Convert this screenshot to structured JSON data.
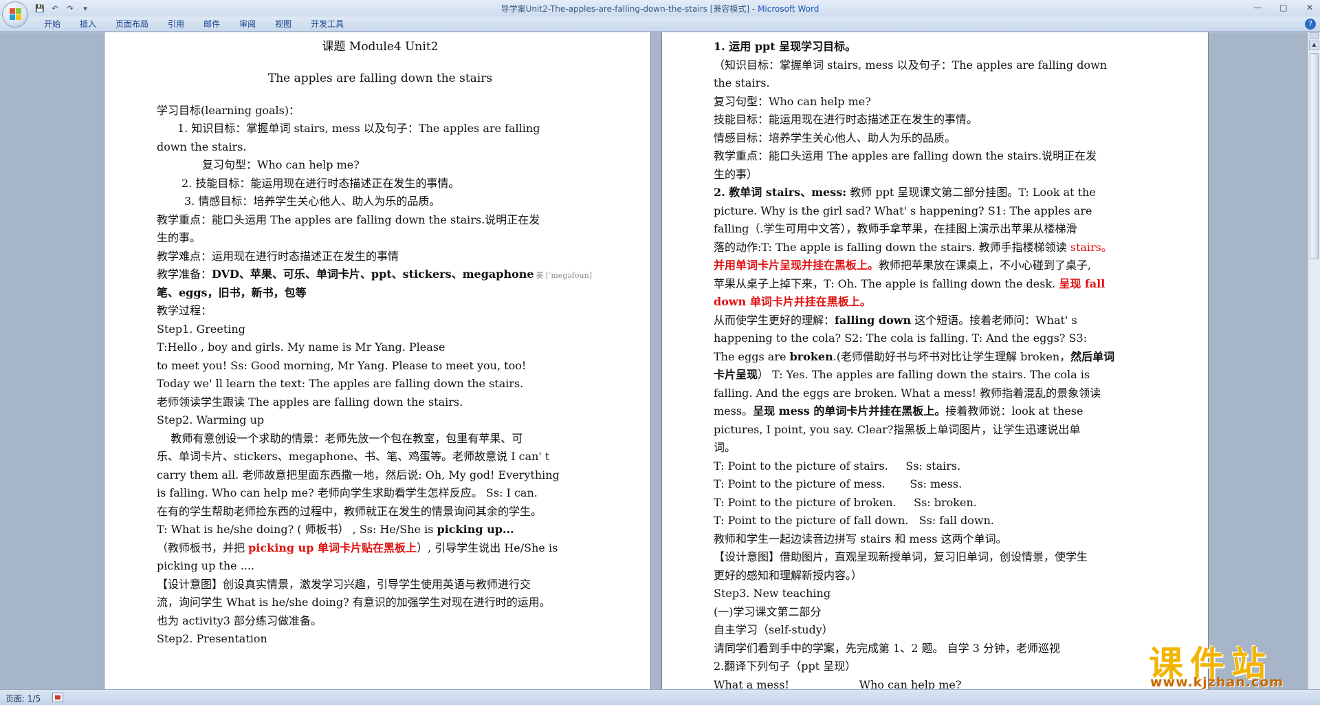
{
  "window": {
    "title": "导学案Unit2-The-apples-are-falling-down-the-stairs [兼容模式] - ",
    "app_name": "Microsoft Word",
    "minimize": "—",
    "maximize": "□",
    "close": "✕"
  },
  "ribbon": {
    "tabs": [
      "开始",
      "插入",
      "页面布局",
      "引用",
      "邮件",
      "审阅",
      "视图",
      "开发工具"
    ],
    "help": "?"
  },
  "qat": {
    "save": "💾",
    "undo": "↶",
    "redo": "↷",
    "more": "▾"
  },
  "page1": {
    "title": "课题 Module4 Unit2",
    "subtitle": "The apples are falling down the stairs",
    "goals_heading": "学习目标(learning goals)：",
    "goal1_a": "1.  知识目标：掌握单词 stairs, mess 以及句子：The apples are falling",
    "goal1_b": "down the stairs.",
    "review": "复习句型：Who can help me?",
    "goal2": "2.  技能目标：能运用现在进行时态描述正在发生的事情。",
    "goal3": "3.  情感目标：培养学生关心他人、助人为乐的品质。",
    "key_a": "教学重点：能口头运用 The apples are falling down the stairs.说明正在发",
    "key_b": "生的事。",
    "difficult": "教学难点：运用现在进行时态描述正在发生的事情",
    "prep_label": "教学准备：",
    "prep_bold": "DVD、苹果、可乐、单词卡片、ppt、stickers、megaphone",
    "prep_phonetic": "美 [ˈmegəfoun]",
    "prep_b": "笔、eggs，旧书，新书，包等",
    "process": "教学过程：",
    "step1": "Step1. Greeting",
    "greet_a": "T:Hello , boy and girls. My name is Mr Yang. Please",
    "greet_b": "to meet you!  Ss: Good morning, Mr Yang.   Please to meet you, too!",
    "greet_c": "Today we' ll learn the text: The apples are falling down the stairs.",
    "greet_d": "老师领读学生跟读 The apples are falling down the stairs.",
    "step2": "Step2. Warming up",
    "warm_a": "    教师有意创设一个求助的情景：老师先放一个包在教室，包里有苹果、可",
    "warm_b": "乐、单词卡片、stickers、megaphone、书、笔、鸡蛋等。老师故意说 I can' t",
    "warm_c": "carry   them all. 老师故意把里面东西撒一地，然后说: Oh, My god! Everything",
    "warm_d": "is falling. Who can help me?    老师向学生求助看学生怎样反应。  Ss: I can.",
    "warm_e": "在有的学生帮助老师捡东西的过程中，教师就正在发生的情景询问其余的学生。",
    "warm_f_a": "T: What is he/she doing? ( 师板书） ,  Ss: He/She is  ",
    "warm_f_b": "picking  up...",
    "warm_g_a": "（教师板书，并把 ",
    "warm_g_red": "picking  up 单词卡片贴在黑板上",
    "warm_g_b": "）, 引导学生说出 He/She is",
    "warm_h": "picking up the ....",
    "design_a": "【设计意图】创设真实情景，激发学习兴趣，引导学生使用英语与教师进行交",
    "design_b": "流，询问学生 What is he/she doing? 有意识的加强学生对现在进行时的运用。",
    "design_c": "也为 activity3 部分练习做准备。",
    "step2p": "Step2. Presentation"
  },
  "page2": {
    "l1": "1. 运用 ppt 呈现学习目标。",
    "l2": "（知识目标：掌握单词 stairs, mess 以及句子：The apples are falling down",
    "l3": "the stairs.",
    "l4": "复习句型：Who can help me?",
    "l5": "技能目标：能运用现在进行时态描述正在发生的事情。",
    "l6": "情感目标：培养学生关心他人、助人为乐的品质。",
    "l7": "教学重点：能口头运用 The apples are falling down the stairs.说明正在发",
    "l8": "生的事）",
    "l9_bold": "2. 教单词 stairs、mess:",
    "l9": " 教师 ppt 呈现课文第二部分挂图。T: Look at the",
    "l10": "picture. Why is the girl sad? What' s happening?  S1: The apples are",
    "l11": "falling（.学生可用中文答），教师手拿苹果，在挂图上演示出苹果从楼梯滑",
    "l12_a": "落的动作:T: The apple is falling down the stairs. 教师手指楼梯领读 ",
    "l12_red": "stairs。",
    "l13_red": "并用单词卡片呈现并挂在黑板上。",
    "l13": "教师把苹果放在课桌上，不小心碰到了桌子,",
    "l14_a": "苹果从桌子上掉下来，T: Oh. The apple is falling down the desk. ",
    "l14_red": "呈现 fall",
    "l15_red": "down 单词卡片并挂在黑板上。",
    "l16_a": "从而使学生更好的理解：",
    "l16_bold": "falling down",
    "l16_b": " 这个短语。接着老师问：What' s",
    "l17": "happening to the cola?  S2: The cola is falling.  T: And the eggs?  S3:",
    "l18_a": "The eggs are ",
    "l18_bold": "broken",
    "l18_b": ".(老师借助好书与坏书对比让学生理解 broken，",
    "l18_bold2": "然后单词",
    "l19_bold": "卡片呈现",
    "l19": "）  T: Yes. The apples are falling down the stairs. The cola is",
    "l20": "falling. And the eggs are broken. What a mess! 教师指着混乱的景象领读",
    "l21_a": "mess。",
    "l21_bold": "呈现 mess 的单词卡片并挂在黑板上。",
    "l21_b": "接着教师说：look at these",
    "l22": "pictures, I point, you say. Clear?指黑板上单词图片，让学生迅速说出单",
    "l23": "词。",
    "l24": "T: Point to the picture of stairs.     Ss: stairs.",
    "l25": "T: Point to the picture of mess.       Ss: mess.",
    "l26": "T: Point to the picture of broken.     Ss: broken.",
    "l27": "T: Point to the picture of fall down.   Ss: fall down.",
    "l28": "教师和学生一起边读音边拼写 stairs 和 mess 这两个单词。",
    "l29": "【设计意图】借助图片，直观呈现新授单词，复习旧单词，创设情景，使学生",
    "l30": "更好的感知和理解新授内容。）",
    "l31": "Step3. New teaching",
    "l32": "(一)学习课文第二部分",
    "l33": "自主学习（self-study）",
    "l34": "请同学们看到手中的学案，先完成第 1、2 题。   自学 3 分钟，老师巡视",
    "l35": "2.翻译下列句子（ppt 呈现）",
    "l36": "What a mess!                    Who can help me?"
  },
  "status": {
    "page": "页面: 1/5"
  },
  "watermark": {
    "brand": "课件站",
    "url": "www.kjzhan.com"
  }
}
